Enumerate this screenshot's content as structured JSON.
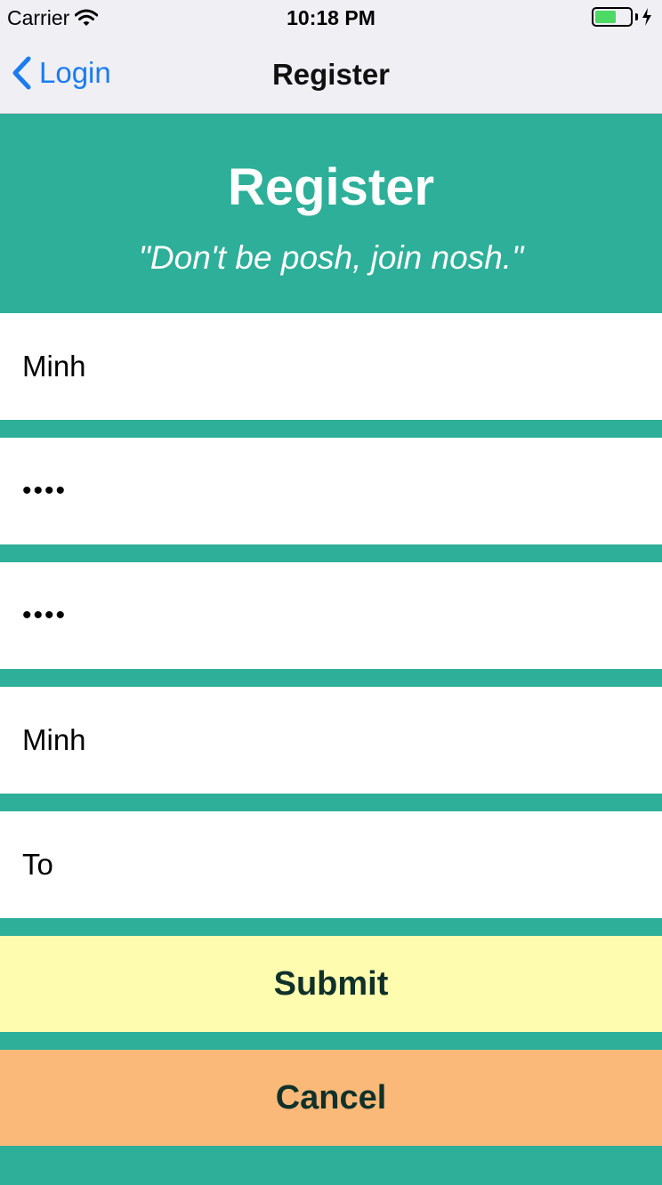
{
  "status_bar": {
    "carrier": "Carrier",
    "time": "10:18 PM",
    "battery_color": "#4cd964"
  },
  "nav": {
    "back_label": "Login",
    "title": "Register"
  },
  "header": {
    "title": "Register",
    "tagline": "\"Don't be posh, join nosh.\""
  },
  "form": {
    "username": "Minh",
    "password": "••••",
    "confirm_password": "••••",
    "first_name": "Minh",
    "last_name": "To"
  },
  "buttons": {
    "submit": "Submit",
    "cancel": "Cancel"
  },
  "colors": {
    "accent": "#2daf99",
    "submit_bg": "#fefcaf",
    "cancel_bg": "#fab978",
    "link": "#1a7cf0"
  }
}
